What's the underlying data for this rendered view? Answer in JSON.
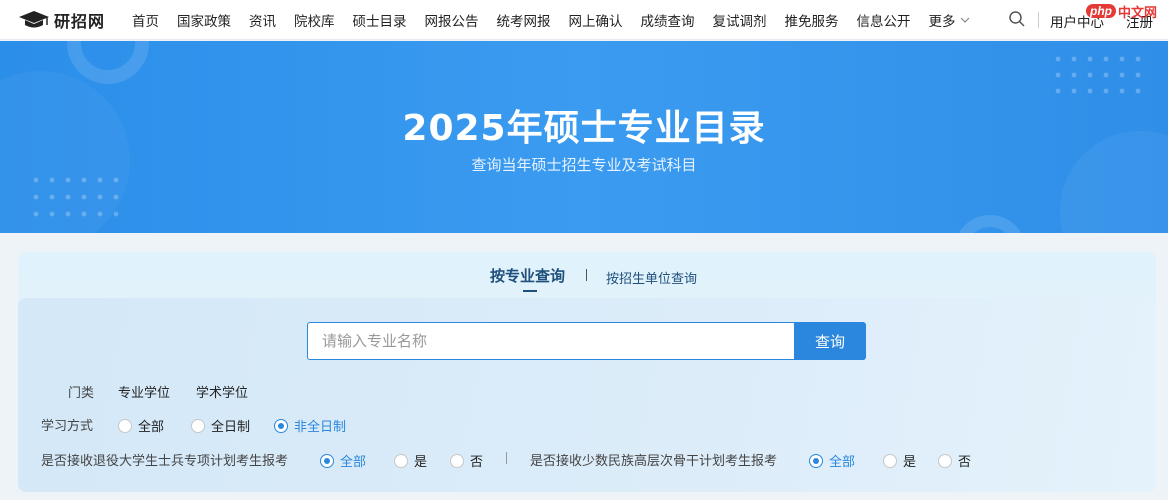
{
  "nav": {
    "logo_text": "研招网",
    "items": [
      "首页",
      "国家政策",
      "资讯",
      "院校库",
      "硕士目录",
      "网报公告",
      "统考网报",
      "网上确认",
      "成绩查询",
      "复试调剂",
      "推免服务",
      "信息公开"
    ],
    "more_label": "更多",
    "user_center": "用户中心",
    "register": "注册",
    "watermark_php": "php",
    "watermark_cn": "中文网"
  },
  "banner": {
    "title": "2025年硕士专业目录",
    "subtitle": "查询当年硕士招生专业及考试科目"
  },
  "tabs": {
    "active": "按专业查询",
    "other": "按招生单位查询"
  },
  "search": {
    "placeholder": "请输入专业名称",
    "button": "查询"
  },
  "filters": {
    "category": {
      "label": "门类",
      "options": [
        "专业学位",
        "学术学位"
      ]
    },
    "study_mode": {
      "label": "学习方式",
      "options": [
        "全部",
        "全日制",
        "非全日制"
      ],
      "selected": "非全日制"
    },
    "veteran_plan": {
      "label": "是否接收退役大学生士兵专项计划考生报考",
      "options": [
        "全部",
        "是",
        "否"
      ],
      "selected": "全部"
    },
    "minority_plan": {
      "label": "是否接收少数民族高层次骨干计划考生报考",
      "options": [
        "全部",
        "是",
        "否"
      ],
      "selected": "全部"
    }
  },
  "colors": {
    "accent": "#2a87dd",
    "banner": "#2f8fe8",
    "tab_text": "#1f4f7d"
  }
}
